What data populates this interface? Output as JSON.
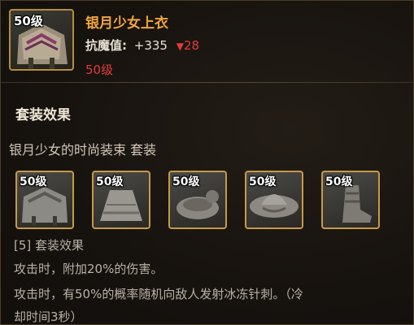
{
  "item": {
    "level_tag": "50级",
    "name": "银月少女上衣",
    "stat_label": "抗魔值:",
    "stat_value": "+335",
    "stat_down_icon": "▼",
    "stat_down_value": "28",
    "required_level": "50级"
  },
  "set": {
    "section_title": "套装效果",
    "set_name": "银月少女的时尚装束 套装",
    "pieces": [
      {
        "level_tag": "50级",
        "icon": "top-icon"
      },
      {
        "level_tag": "50级",
        "icon": "skirt-icon"
      },
      {
        "level_tag": "50级",
        "icon": "belt-icon"
      },
      {
        "level_tag": "50级",
        "icon": "hat-icon"
      },
      {
        "level_tag": "50级",
        "icon": "boots-icon"
      }
    ],
    "effect_header": "[5] 套装效果",
    "effect_line1": "攻击时，附加20%的伤害。",
    "effect_line2": "攻击时，有50%的概率随机向敌人发射冰冻针刺。（冷",
    "effect_line3": "却时间3秒）"
  },
  "colors": {
    "item_name": "#f0a53c",
    "negative": "#e23b3b",
    "frame_gold": "#c79a45"
  }
}
